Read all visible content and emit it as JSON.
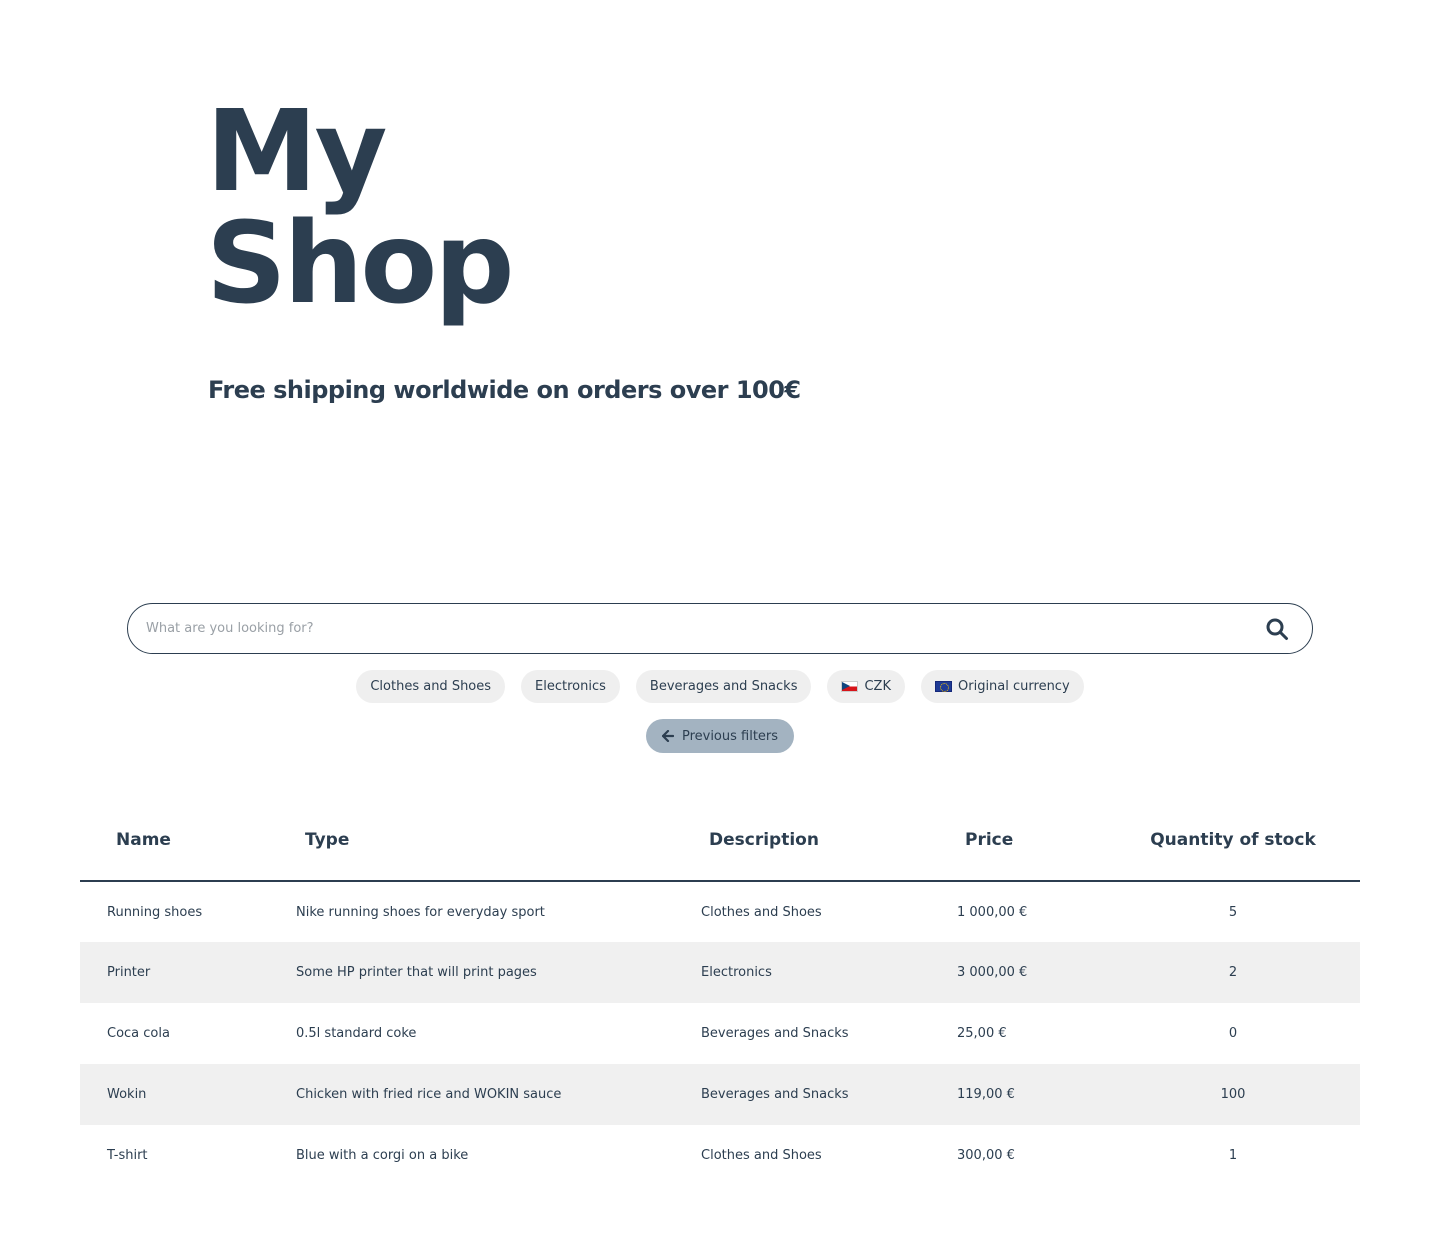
{
  "header": {
    "title_line1": "My",
    "title_line2": "Shop",
    "subtitle": "Free shipping worldwide on orders over 100€"
  },
  "search": {
    "placeholder": "What are you looking for?",
    "icon": "search-icon"
  },
  "filters": [
    {
      "label": "Clothes and Shoes"
    },
    {
      "label": "Electronics"
    },
    {
      "label": "Beverages and Snacks"
    },
    {
      "label": "CZK",
      "icon": "czech-flag-icon"
    },
    {
      "label": "Original currency",
      "icon": "eu-flag-icon"
    }
  ],
  "previous_filters": {
    "label": "Previous filters",
    "icon": "arrow-left-icon"
  },
  "table": {
    "headers": [
      "Name",
      "Type",
      "Description",
      "Price",
      "Quantity of stock"
    ],
    "rows": [
      [
        "Running shoes",
        "Nike running shoes for everyday sport",
        "Clothes and Shoes",
        "1 000,00 €",
        "5"
      ],
      [
        "Printer",
        "Some HP printer that will print pages",
        "Electronics",
        "3 000,00 €",
        "2"
      ],
      [
        "Coca cola",
        "0.5l standard coke",
        "Beverages and Snacks",
        "25,00 €",
        "0"
      ],
      [
        "Wokin",
        "Chicken with fried rice and WOKIN sauce",
        "Beverages and Snacks",
        "119,00 €",
        "100"
      ],
      [
        "T-shirt",
        "Blue with a corgi on a bike",
        "Clothes and Shoes",
        "300,00 €",
        "1"
      ]
    ]
  },
  "colors": {
    "text": "#2c3e50",
    "chip_bg": "#efefef",
    "prev_button_bg": "#a3b3c1",
    "row_alt_bg": "#f0f0f0"
  }
}
